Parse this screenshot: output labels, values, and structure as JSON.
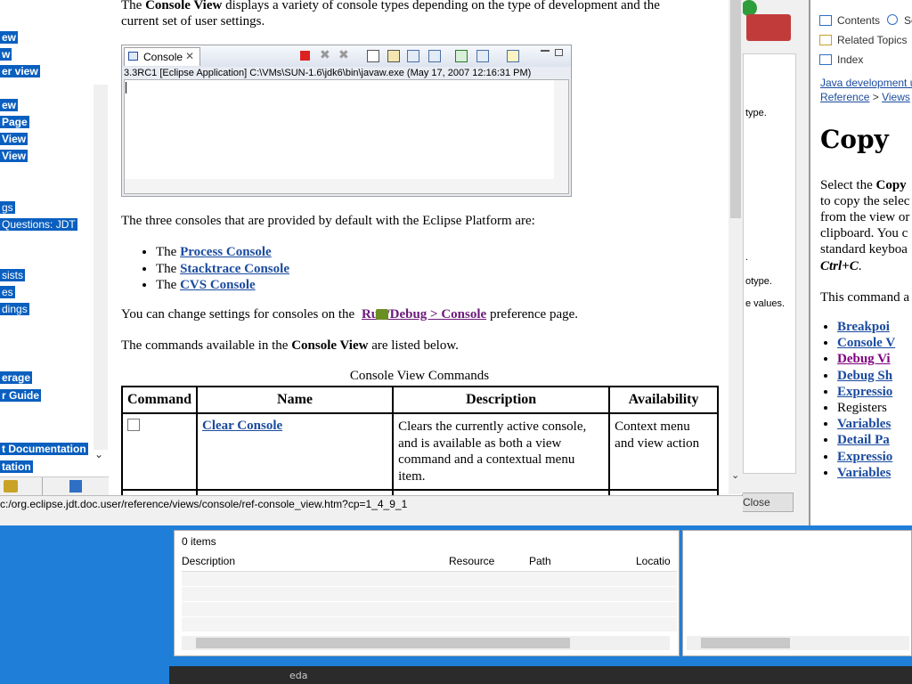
{
  "main": {
    "intro_text_1": "The ",
    "intro_bold": "Console View",
    "intro_text_2": " displays a variety of console types depending on the type of development and the",
    "intro_line2": "current set of user settings.",
    "console_tab_label": "Console",
    "console_path": "3.3RC1 [Eclipse Application] C:\\VMs\\SUN-1.6\\jdk6\\bin\\javaw.exe (May 17, 2007 12:16:31 PM)",
    "three_consoles_text": "The three consoles that are provided by default with the Eclipse Platform are:",
    "console_list": [
      {
        "prefix": "The ",
        "link": "Process Console"
      },
      {
        "prefix": "The ",
        "link": "Stacktrace Console"
      },
      {
        "prefix": "The ",
        "link": "CVS Console"
      }
    ],
    "settings_text_1": "You can change settings for consoles on the ",
    "settings_link": " Run/Debug > Console",
    "settings_text_2": " preference page.",
    "commands_text_1": "The commands available in the ",
    "commands_bold": "Console View",
    "commands_text_2": " are listed below.",
    "table_caption": "Console View Commands",
    "table_headers": [
      "Command",
      "Name",
      "Description",
      "Availability"
    ],
    "table_rows": [
      {
        "name": "Clear Console",
        "description": "Clears the currently active console, and is available as both a view command and a contextual menu item.",
        "availability": "Context menu and view action"
      }
    ]
  },
  "status_url": "c:/org.eclipse.jdt.doc.user/reference/views/console/ref-console_view.htm?cp=1_4_9_1",
  "left_toc": {
    "items": [
      {
        "label": "ew",
        "bold": true
      },
      {
        "label": "w",
        "bold": true
      },
      {
        "label": "er view",
        "bold": true
      },
      {
        "label": "ew",
        "bold": true
      },
      {
        "label": " Page",
        "bold": true
      },
      {
        "label": "View",
        "bold": true
      },
      {
        "label": "View",
        "bold": true
      },
      {
        "label": "gs",
        "bold": false
      },
      {
        "label": "Questions: JDT",
        "bold": true
      },
      {
        "label": "sists",
        "bold": true
      },
      {
        "label": "es",
        "bold": true
      },
      {
        "label": "dings",
        "bold": true
      },
      {
        "label": "erage",
        "bold": true
      },
      {
        "label": "r Guide",
        "bold": true
      },
      {
        "label": "t Documentation",
        "bold": true
      },
      {
        "label": "tation",
        "bold": true
      }
    ]
  },
  "right_help": {
    "tabs": [
      "Contents",
      "Se",
      "Related Topics",
      "Index"
    ],
    "breadcrumb_1": "Java development u",
    "breadcrumb_2": "Reference",
    "breadcrumb_sep": " > ",
    "breadcrumb_3": "Views",
    "breadcrumb_tail": " >",
    "title": "Copy",
    "para_lines": [
      "Select the ",
      "to copy the selec",
      "from the view or",
      "clipboard. You c",
      "standard keyboa"
    ],
    "para_bold": "Copy",
    "shortcut": "Ctrl+C",
    "shortcut_end": ".",
    "applies_text": "This command a",
    "links": [
      {
        "label": "Breakpoi",
        "visited": false
      },
      {
        "label": "Console V",
        "visited": false
      },
      {
        "label": "Debug Vi",
        "visited": true
      },
      {
        "label": "Debug Sh",
        "visited": false
      },
      {
        "label": "Expressio",
        "visited": false
      },
      {
        "label": "Registers ",
        "visited": false,
        "plain": true
      },
      {
        "label": "Variables",
        "visited": false
      },
      {
        "label": "Detail Pa",
        "visited": false
      },
      {
        "label": "Expressio",
        "visited": false
      },
      {
        "label": "Variables",
        "visited": false
      }
    ]
  },
  "dialog": {
    "fragments": [
      "type.",
      ".",
      "otype.",
      "e values."
    ],
    "close_label": "Close"
  },
  "problems": {
    "count": "0 items",
    "columns": [
      "Description",
      "Resource",
      "Path",
      "Locatio"
    ]
  },
  "taskbar": {
    "item": "eda"
  }
}
